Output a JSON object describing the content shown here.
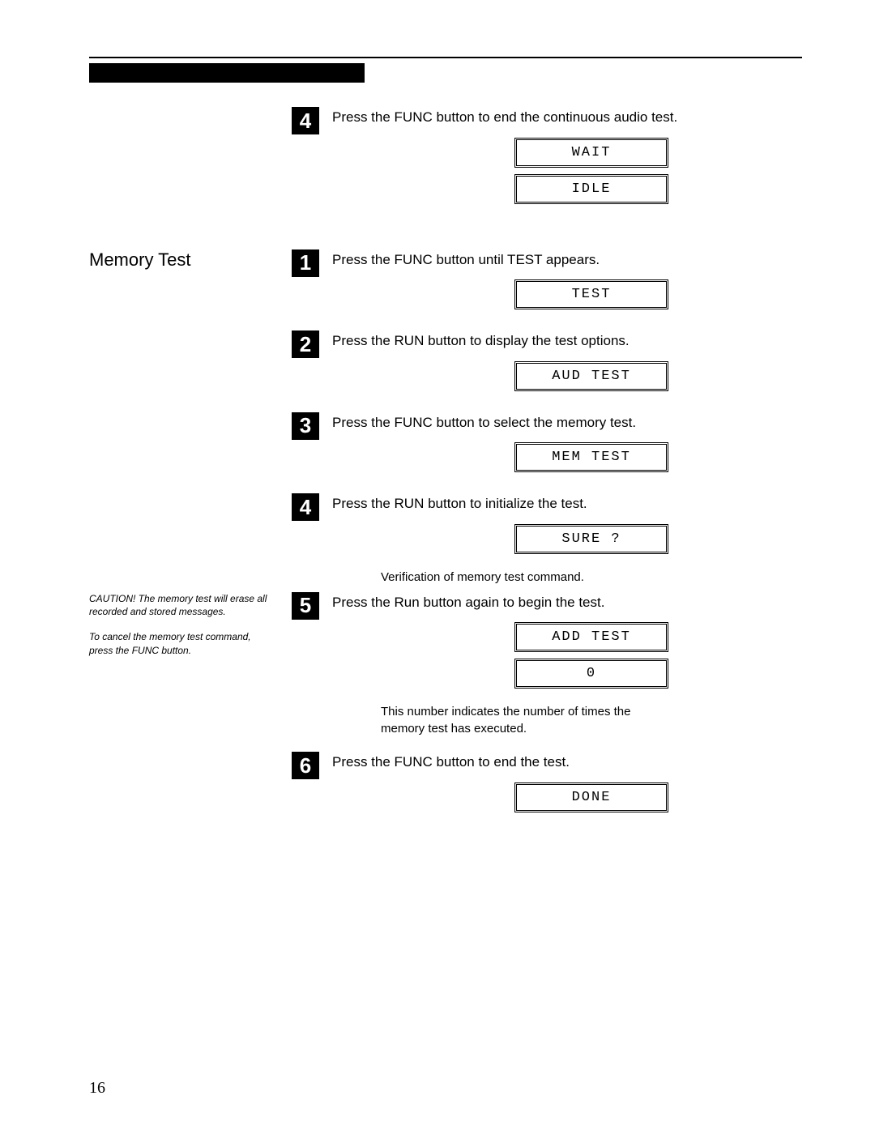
{
  "intro_step": {
    "num": "4",
    "text": "Press the FUNC  button to end the continuous audio test.",
    "displays": [
      "WAIT",
      "IDLE"
    ]
  },
  "section": {
    "heading": "Memory Test",
    "notes": [
      "CAUTION! The memory test will erase all recorded and stored messages.",
      "To cancel the memory test command, press the FUNC button."
    ],
    "steps": [
      {
        "num": "1",
        "text": "Press the FUNC  button until TEST appears.",
        "displays": [
          "TEST"
        ]
      },
      {
        "num": "2",
        "text": "Press the RUN button to display the test options.",
        "displays": [
          "AUD TEST"
        ]
      },
      {
        "num": "3",
        "text": "Press the FUNC  button to select the memory test.",
        "displays": [
          "MEM TEST"
        ]
      },
      {
        "num": "4",
        "text": "Press the RUN button to initialize the test.",
        "displays": [
          "SURE ?"
        ],
        "caption": "Verification of memory test command."
      },
      {
        "num": "5",
        "text": "Press the Run button again to begin the test.",
        "displays": [
          "ADD TEST",
          "0"
        ],
        "caption": "This number indicates the number of times the memory test has executed."
      },
      {
        "num": "6",
        "text": "Press the FUNC  button to end the test.",
        "displays": [
          "DONE"
        ]
      }
    ]
  },
  "page_number": "16"
}
